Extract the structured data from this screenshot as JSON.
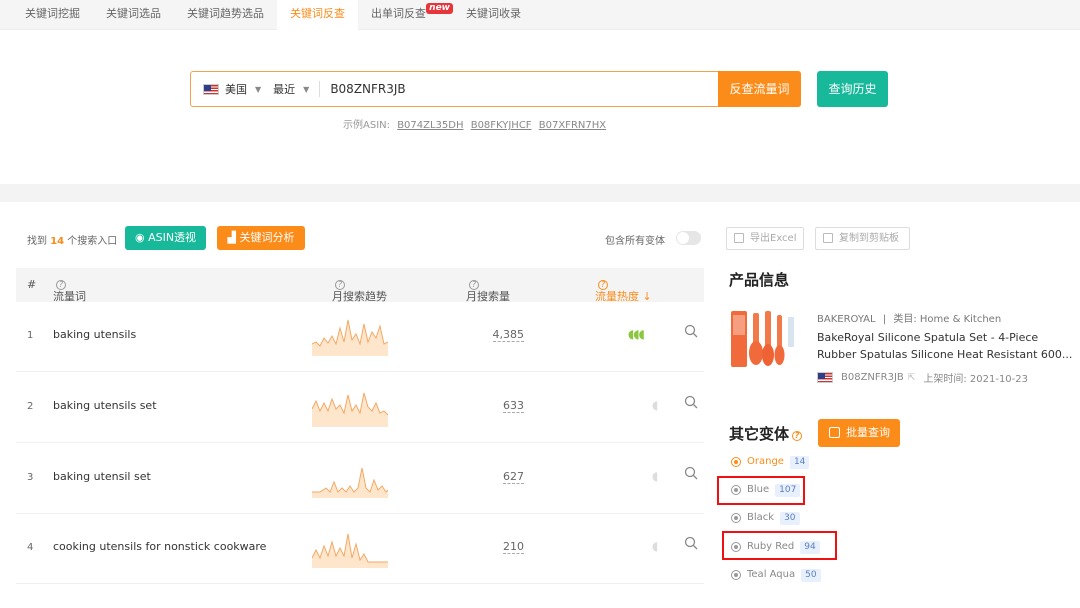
{
  "tabs": [
    {
      "label": "关键词挖掘",
      "active": false
    },
    {
      "label": "关键词选品",
      "active": false
    },
    {
      "label": "关键词趋势选品",
      "active": false
    },
    {
      "label": "关键词反查",
      "active": true
    },
    {
      "label": "出单词反查",
      "active": false,
      "badge": "new"
    },
    {
      "label": "关键词收录",
      "active": false
    }
  ],
  "search": {
    "country": "美国",
    "period": "最近",
    "asin_value": "B08ZNFR3JB",
    "submit_label": "反查流量词",
    "history_label": "查询历史",
    "examples_label": "示例ASIN:",
    "examples": [
      "B074ZL35DH",
      "B08FKYJHCF",
      "B07XFRN7HX"
    ]
  },
  "toolbar": {
    "found_prefix": "找到",
    "found_count": "14",
    "found_suffix": "个搜索入口",
    "asin_btn": "ASIN透视",
    "kw_btn": "关键词分析",
    "variants_label": "包含所有变体",
    "variants_on": false
  },
  "table": {
    "headers": {
      "index": "#",
      "keyword": "流量词",
      "trend": "月搜索趋势",
      "volume": "月搜索量",
      "heat": "流量热度 ↓"
    },
    "rows": [
      {
        "index": "1",
        "keyword": "baking utensils",
        "volume": "4,385",
        "heat_level": 3
      },
      {
        "index": "2",
        "keyword": "baking utensils set",
        "volume": "633",
        "heat_level": 0
      },
      {
        "index": "3",
        "keyword": "baking utensil set",
        "volume": "627",
        "heat_level": 0
      },
      {
        "index": "4",
        "keyword": "cooking utensils for nonstick cookware",
        "volume": "210",
        "heat_level": 0
      }
    ]
  },
  "right": {
    "export_label": "导出Excel",
    "copy_label": "复制到剪贴板",
    "product_title": "产品信息",
    "brand": "BAKEROYAL",
    "category_sep": "|",
    "category_label": "类目: Home & Kitchen",
    "product_name_line1": "BakeRoyal Silicone Spatula Set - 4-Piece",
    "product_name_line2": "Rubber Spatulas Silicone Heat Resistant 600...",
    "asin": "B08ZNFR3JB",
    "launch_label": "上架时间: 2021-10-23",
    "variants_title": "其它变体",
    "batch_label": "批量查询",
    "variants": [
      {
        "name": "Orange",
        "count": "14",
        "active": true
      },
      {
        "name": "Blue",
        "count": "107",
        "active": false
      },
      {
        "name": "Black",
        "count": "30",
        "active": false
      },
      {
        "name": "Ruby Red",
        "count": "94",
        "active": false
      },
      {
        "name": "Teal Aqua",
        "count": "50",
        "active": false
      }
    ]
  },
  "colors": {
    "accent_orange": "#fb8c19",
    "accent_teal": "#18b99a",
    "heat_green": "#8cc63f",
    "highlight_red": "#e11111"
  }
}
